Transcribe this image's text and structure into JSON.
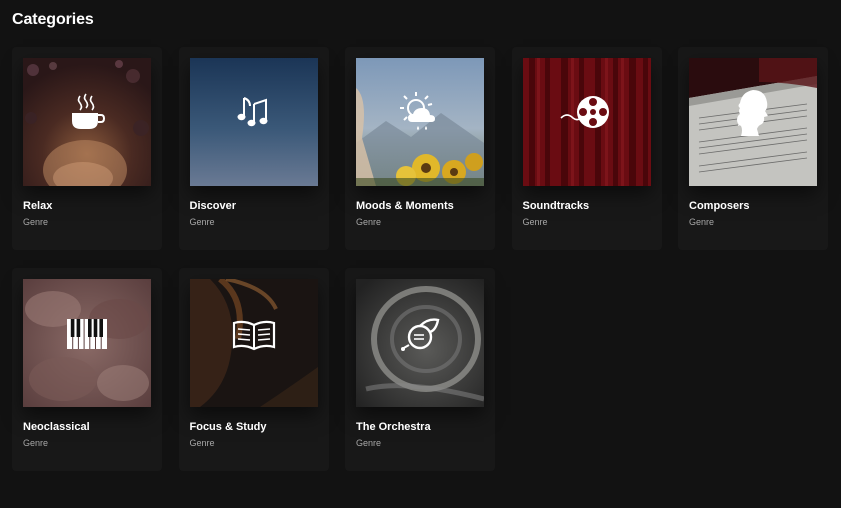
{
  "section": {
    "title": "Categories"
  },
  "categories": [
    {
      "title": "Relax",
      "subtitle": "Genre",
      "icon": "coffee-cup-icon"
    },
    {
      "title": "Discover",
      "subtitle": "Genre",
      "icon": "music-notes-icon"
    },
    {
      "title": "Moods & Moments",
      "subtitle": "Genre",
      "icon": "sun-cloud-rain-icon"
    },
    {
      "title": "Soundtracks",
      "subtitle": "Genre",
      "icon": "film-reel-icon"
    },
    {
      "title": "Composers",
      "subtitle": "Genre",
      "icon": "composer-silhouette-icon"
    },
    {
      "title": "Neoclassical",
      "subtitle": "Genre",
      "icon": "piano-keys-icon"
    },
    {
      "title": "Focus & Study",
      "subtitle": "Genre",
      "icon": "open-book-icon"
    },
    {
      "title": "The Orchestra",
      "subtitle": "Genre",
      "icon": "french-horn-icon"
    }
  ],
  "colors": {
    "background": "#121212",
    "card": "#181818",
    "subtitle": "#a7a7a7"
  }
}
